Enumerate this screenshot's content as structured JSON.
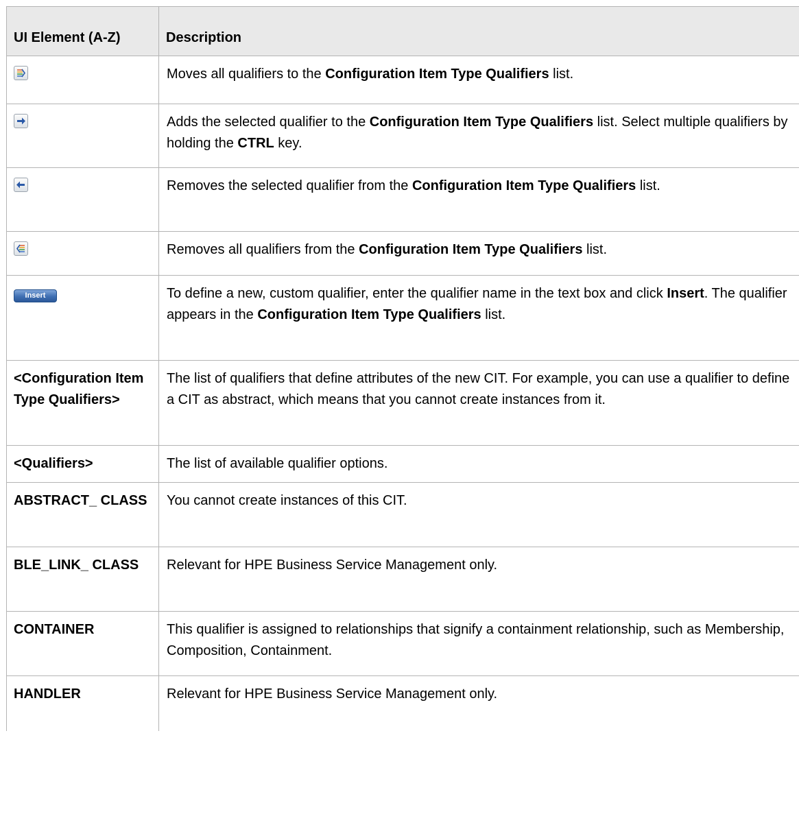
{
  "header": {
    "col1": "UI Element (A-Z)",
    "col2": "Description"
  },
  "icons": {
    "move_all_right": "move-all-right-icon",
    "move_right": "move-right-icon",
    "move_left": "move-left-icon",
    "move_all_left": "move-all-left-icon"
  },
  "insert_button_label": "Insert",
  "rows": [
    {
      "d1": "Moves all qualifiers to the ",
      "d2": "Configuration Item Type Qualifiers",
      "d3": " list."
    },
    {
      "d1": "Adds the selected qualifier to the ",
      "d2": "Configuration Item Type Qualifiers",
      "d3": " list. Select multiple qualifiers by holding the ",
      "d4": "CTRL",
      "d5": " key."
    },
    {
      "d1": "Removes the selected qualifier from the ",
      "d2": "Configuration Item Type Qualifiers",
      "d3": " list."
    },
    {
      "d1": "Removes all qualifiers from the ",
      "d2": "Configuration Item Type Qualifiers",
      "d3": " list."
    },
    {
      "d1": "To define a new, custom qualifier, enter the qualifier name in the text box and click ",
      "d2": "Insert",
      "d3": ". The qualifier appears in the ",
      "d4": "Configuration Item Type Qualifiers",
      "d5": " list."
    },
    {
      "element": "<Configuration Item Type Qualifiers>",
      "desc": "The list of qualifiers that define attributes of the new CIT. For example, you can use a qualifier to define a CIT as abstract, which means that you cannot create instances from it."
    },
    {
      "element": "<Qualifiers>",
      "desc": "The list of available qualifier options."
    },
    {
      "element": "ABSTRACT_ CLASS",
      "desc": "You cannot create instances of this CIT."
    },
    {
      "element": "BLE_LINK_ CLASS",
      "desc": "Relevant for HPE Business Service Management only."
    },
    {
      "element": "CONTAINER",
      "desc": "This qualifier is assigned to relationships that signify a containment relationship, such as Membership, Composition, Containment."
    },
    {
      "element": "HANDLER",
      "desc": "Relevant for HPE Business Service Management only."
    }
  ]
}
